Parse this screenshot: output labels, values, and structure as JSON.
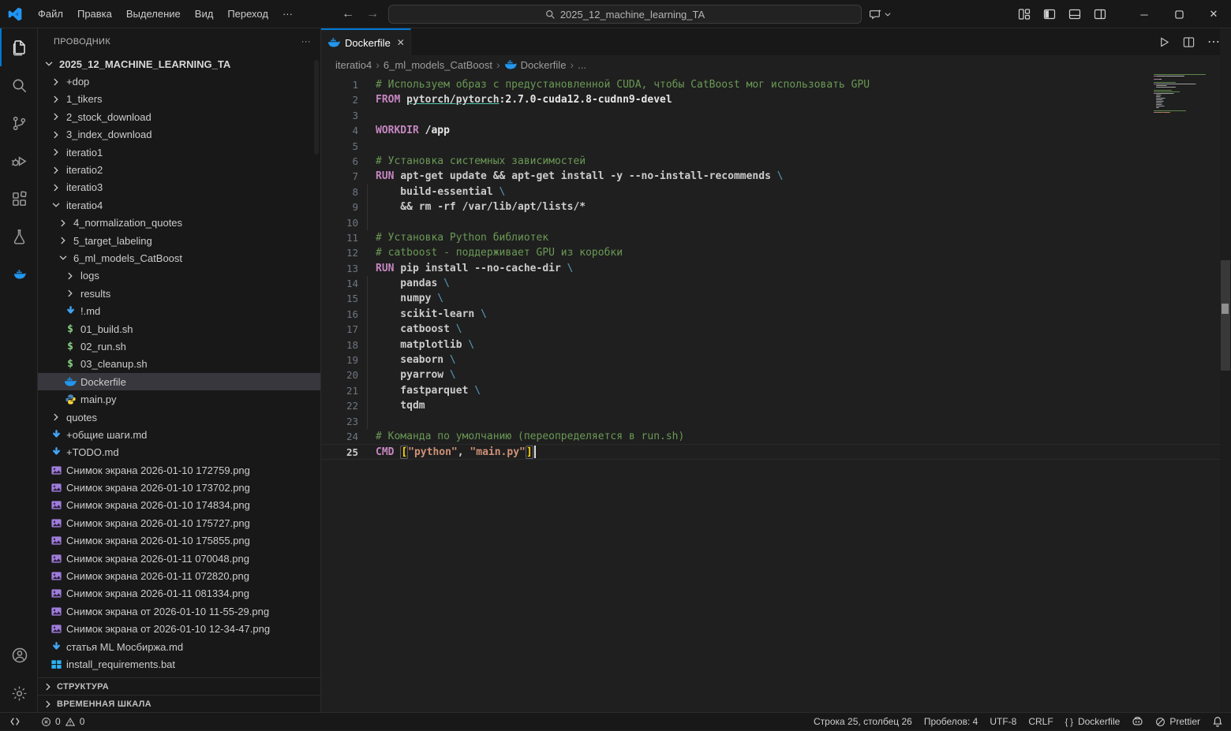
{
  "colors": {
    "accent": "#0078d4",
    "comment": "#6a9955",
    "keyword": "#c586c0",
    "string": "#ce9178",
    "bracket": "#ffd700",
    "docker_blue": "#2396ed",
    "shell_green": "#89d185",
    "image_purple": "#9f7ddb",
    "md_blue": "#42a5f5",
    "bat_blue": "#29b6f6"
  },
  "titlebar": {
    "menus": [
      "Файл",
      "Правка",
      "Выделение",
      "Вид",
      "Переход",
      "···"
    ],
    "search": {
      "value": "2025_12_machine_learning_TA"
    },
    "window_controls": {
      "minimize": "─",
      "maximize": "☐",
      "close": "✕"
    }
  },
  "activity_bar": {
    "top": [
      {
        "name": "explorer",
        "active": true
      },
      {
        "name": "search",
        "active": false
      },
      {
        "name": "source-control",
        "active": false
      },
      {
        "name": "run-debug",
        "active": false
      },
      {
        "name": "extensions",
        "active": false
      },
      {
        "name": "testing",
        "active": false
      },
      {
        "name": "docker",
        "active": false
      }
    ],
    "bottom": [
      {
        "name": "account",
        "active": false
      },
      {
        "name": "settings",
        "active": false
      }
    ]
  },
  "sidebar": {
    "title": "ПРОВОДНИК",
    "more_actions": "···",
    "tree": [
      {
        "label": "2025_12_MACHINE_LEARNING_TA",
        "lvl": 0,
        "icon": "chevron-down",
        "root": true
      },
      {
        "label": "+dop",
        "lvl": 1,
        "icon": "chevron-right"
      },
      {
        "label": "1_tikers",
        "lvl": 1,
        "icon": "chevron-right"
      },
      {
        "label": "2_stock_download",
        "lvl": 1,
        "icon": "chevron-right"
      },
      {
        "label": "3_index_download",
        "lvl": 1,
        "icon": "chevron-right"
      },
      {
        "label": "iteratio1",
        "lvl": 1,
        "icon": "chevron-right"
      },
      {
        "label": "iteratio2",
        "lvl": 1,
        "icon": "chevron-right"
      },
      {
        "label": "iteratio3",
        "lvl": 1,
        "icon": "chevron-right"
      },
      {
        "label": "iteratio4",
        "lvl": 1,
        "icon": "chevron-down"
      },
      {
        "label": "4_normalization_quotes",
        "lvl": 2,
        "icon": "chevron-right"
      },
      {
        "label": "5_target_labeling",
        "lvl": 2,
        "icon": "chevron-right"
      },
      {
        "label": "6_ml_models_CatBoost",
        "lvl": 2,
        "icon": "chevron-down"
      },
      {
        "label": "logs",
        "lvl": 3,
        "icon": "chevron-right"
      },
      {
        "label": "results",
        "lvl": 3,
        "icon": "chevron-right"
      },
      {
        "label": "!.md",
        "lvl": 3,
        "icon": "md"
      },
      {
        "label": "01_build.sh",
        "lvl": 3,
        "icon": "sh"
      },
      {
        "label": "02_run.sh",
        "lvl": 3,
        "icon": "sh"
      },
      {
        "label": "03_cleanup.sh",
        "lvl": 3,
        "icon": "sh"
      },
      {
        "label": "Dockerfile",
        "lvl": 3,
        "icon": "docker",
        "selected": true
      },
      {
        "label": "main.py",
        "lvl": 3,
        "icon": "py"
      },
      {
        "label": "quotes",
        "lvl": 1,
        "icon": "chevron-right"
      },
      {
        "label": "+общие шаги.md",
        "lvl": 1,
        "icon": "md"
      },
      {
        "label": "+TODO.md",
        "lvl": 1,
        "icon": "md"
      },
      {
        "label": "Снимок экрана 2026-01-10 172759.png",
        "lvl": 1,
        "icon": "img"
      },
      {
        "label": "Снимок экрана 2026-01-10 173702.png",
        "lvl": 1,
        "icon": "img"
      },
      {
        "label": "Снимок экрана 2026-01-10 174834.png",
        "lvl": 1,
        "icon": "img"
      },
      {
        "label": "Снимок экрана 2026-01-10 175727.png",
        "lvl": 1,
        "icon": "img"
      },
      {
        "label": "Снимок экрана 2026-01-10 175855.png",
        "lvl": 1,
        "icon": "img"
      },
      {
        "label": "Снимок экрана 2026-01-11 070048.png",
        "lvl": 1,
        "icon": "img"
      },
      {
        "label": "Снимок экрана 2026-01-11 072820.png",
        "lvl": 1,
        "icon": "img"
      },
      {
        "label": "Снимок экрана 2026-01-11 081334.png",
        "lvl": 1,
        "icon": "img"
      },
      {
        "label": "Снимок экрана от 2026-01-10 11-55-29.png",
        "lvl": 1,
        "icon": "img"
      },
      {
        "label": "Снимок экрана от 2026-01-10 12-34-47.png",
        "lvl": 1,
        "icon": "img"
      },
      {
        "label": "статья ML Мосбиржа.md",
        "lvl": 1,
        "icon": "md"
      },
      {
        "label": "install_requirements.bat",
        "lvl": 1,
        "icon": "bat"
      }
    ],
    "sections": [
      "СТРУКТУРА",
      "ВРЕМЕННАЯ ШКАЛА"
    ]
  },
  "editor": {
    "tab": {
      "label": "Dockerfile",
      "close": "✕"
    },
    "breadcrumbs": [
      "iteratio4",
      "6_ml_models_CatBoost",
      "Dockerfile",
      "..."
    ],
    "lines": [
      {
        "n": 1,
        "segs": [
          [
            "c",
            "# Используем образ с предустановленной CUDA, чтобы CatBoost мог использовать GPU"
          ]
        ]
      },
      {
        "n": 2,
        "segs": [
          [
            "k",
            "FROM "
          ],
          [
            "lk",
            "pytorch/pytorch"
          ],
          [
            "stg",
            ":2.7.0-cuda12.8-cudnn9-devel"
          ]
        ]
      },
      {
        "n": 3,
        "segs": []
      },
      {
        "n": 4,
        "segs": [
          [
            "k",
            "WORKDIR "
          ],
          [
            "stg",
            "/app"
          ]
        ]
      },
      {
        "n": 5,
        "segs": []
      },
      {
        "n": 6,
        "segs": [
          [
            "c",
            "# Установка системных зависимостей"
          ]
        ]
      },
      {
        "n": 7,
        "segs": [
          [
            "k",
            "RUN "
          ],
          [
            "t",
            "apt-get update && apt-get install -y --no-install-recommends "
          ],
          [
            "e",
            "\\"
          ]
        ]
      },
      {
        "n": 8,
        "segs": [
          [
            "t",
            "    build-essential "
          ],
          [
            "e",
            "\\"
          ]
        ],
        "guide": true
      },
      {
        "n": 9,
        "segs": [
          [
            "t",
            "    && rm -rf /var/lib/apt/lists/*"
          ]
        ],
        "guide": true
      },
      {
        "n": 10,
        "segs": [],
        "guide": true
      },
      {
        "n": 11,
        "segs": [
          [
            "c",
            "# Установка Python библиотек"
          ]
        ]
      },
      {
        "n": 12,
        "segs": [
          [
            "c",
            "# catboost - поддерживает GPU из коробки"
          ]
        ]
      },
      {
        "n": 13,
        "segs": [
          [
            "k",
            "RUN "
          ],
          [
            "t",
            "pip install --no-cache-dir "
          ],
          [
            "e",
            "\\"
          ]
        ]
      },
      {
        "n": 14,
        "segs": [
          [
            "t",
            "    pandas "
          ],
          [
            "e",
            "\\"
          ]
        ],
        "guide": true
      },
      {
        "n": 15,
        "segs": [
          [
            "t",
            "    numpy "
          ],
          [
            "e",
            "\\"
          ]
        ],
        "guide": true
      },
      {
        "n": 16,
        "segs": [
          [
            "t",
            "    scikit-learn "
          ],
          [
            "e",
            "\\"
          ]
        ],
        "guide": true
      },
      {
        "n": 17,
        "segs": [
          [
            "t",
            "    catboost "
          ],
          [
            "e",
            "\\"
          ]
        ],
        "guide": true
      },
      {
        "n": 18,
        "segs": [
          [
            "t",
            "    matplotlib "
          ],
          [
            "e",
            "\\"
          ]
        ],
        "guide": true
      },
      {
        "n": 19,
        "segs": [
          [
            "t",
            "    seaborn "
          ],
          [
            "e",
            "\\"
          ]
        ],
        "guide": true
      },
      {
        "n": 20,
        "segs": [
          [
            "t",
            "    pyarrow "
          ],
          [
            "e",
            "\\"
          ]
        ],
        "guide": true
      },
      {
        "n": 21,
        "segs": [
          [
            "t",
            "    fastparquet "
          ],
          [
            "e",
            "\\"
          ]
        ],
        "guide": true
      },
      {
        "n": 22,
        "segs": [
          [
            "t",
            "    tqdm"
          ]
        ],
        "guide": true
      },
      {
        "n": 23,
        "segs": [],
        "guide": true
      },
      {
        "n": 24,
        "segs": [
          [
            "c",
            "# Команда по умолчанию (переопределяется в run.sh)"
          ]
        ]
      },
      {
        "n": 25,
        "segs": [
          [
            "k",
            "CMD "
          ],
          [
            "b",
            "["
          ],
          [
            "s",
            "\"python\""
          ],
          [
            "t",
            ", "
          ],
          [
            "s",
            "\"main.py\""
          ],
          [
            "b",
            "]"
          ]
        ],
        "active": true
      }
    ]
  },
  "status_bar": {
    "problems": {
      "errors": "0",
      "warnings": "0"
    },
    "right": [
      {
        "label": "Строка 25, столбец 26"
      },
      {
        "label": "Пробелов: 4"
      },
      {
        "label": "UTF-8"
      },
      {
        "label": "CRLF"
      },
      {
        "icon": "braces",
        "label": "Dockerfile"
      },
      {
        "icon": "copilot",
        "label": ""
      },
      {
        "icon": "slash-circle",
        "label": "Prettier"
      },
      {
        "icon": "bell",
        "label": ""
      }
    ]
  }
}
